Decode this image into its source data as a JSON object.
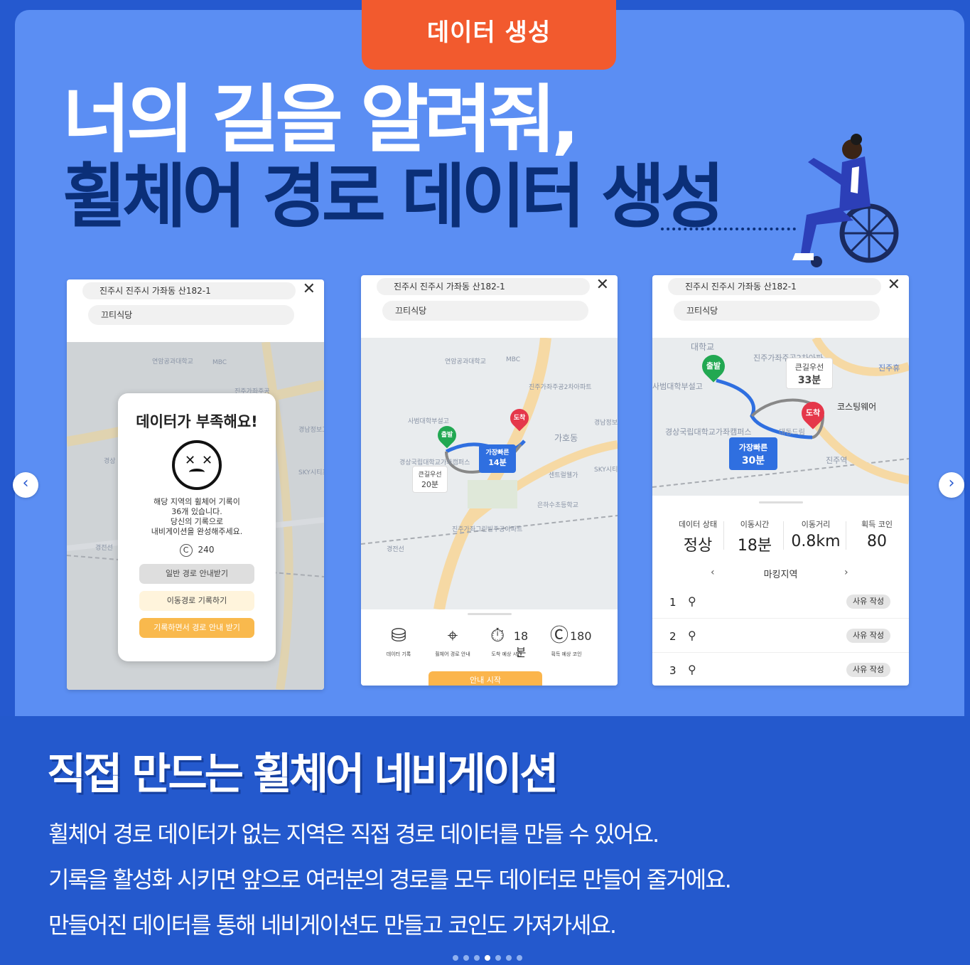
{
  "tag": "데이터 생성",
  "headline": {
    "line1": "너의 길을 알려줘,",
    "line2": "휠체어 경로 데이터 생성"
  },
  "phone1": {
    "address": "진주시 진주시 가좌동 산182-1",
    "place": "끄티식당",
    "dialog": {
      "title": "데이터가 부족해요!",
      "text_lines": [
        "해당 지역의 휠체어 기록이",
        "36개 있습니다.",
        "당신의 기록으로",
        "내비게이션을 완성해주세요."
      ],
      "coin_value": "240",
      "btn_normal": "일반 경로 안내받기",
      "btn_record": "이동경로 기록하기",
      "btn_guide": "기록하면서 경로 안내 받기"
    },
    "map_labels": [
      "연암공과대학교",
      "MBC",
      "진주가좌주공",
      "경남정보고등학교",
      "경상",
      "SKY시티프라디움",
      "경전선"
    ]
  },
  "phone2": {
    "address": "진주시 진주시 가좌동 산182-1",
    "place": "끄티식당",
    "pin_start": "출발",
    "pin_end": "도착",
    "fast_route": {
      "label": "가장빠른",
      "time": "14분"
    },
    "big_route": {
      "label": "큰길우선",
      "time": "20분"
    },
    "map_labels": [
      "연암공과대학교",
      "MBC",
      "진주가좌주공2차아파트",
      "사범대학부설고",
      "가호동",
      "경남정보고등학교",
      "경상국립대학교가좌캠퍼스",
      "센트럴웰가",
      "SKY시티프라디움",
      "은하수초등학교",
      "진주가좌그린빌주공아파트",
      "경전선"
    ],
    "tools": [
      {
        "icon": "database-add-icon",
        "label": "데이터 기록",
        "value": ""
      },
      {
        "icon": "map-pin-icon",
        "label": "휠체어 경로 안내",
        "value": ""
      },
      {
        "icon": "timer-icon",
        "label": "도착 예상 시간",
        "value": "18분"
      },
      {
        "icon": "coin-icon",
        "label": "획득 예상 코인",
        "value": "180"
      }
    ],
    "start_button": "안내 시작"
  },
  "phone3": {
    "address": "진주시 진주시 가좌동 산182-1",
    "place": "끄티식당",
    "pin_start": "출발",
    "pin_end": "도착",
    "big_route": {
      "label": "큰길우선",
      "time": "33분"
    },
    "fast_route": {
      "label": "가장빠른",
      "time": "30분"
    },
    "map_labels": [
      "대학교",
      "진주가좌주공2차아파",
      "진주휴",
      "사범대학부설고",
      "코스팅웨어",
      "경상국립대학교가좌캠퍼스",
      "진주역",
      "대동드림"
    ],
    "stats": [
      {
        "key": "데이터 상태",
        "value": "정상"
      },
      {
        "key": "이동시간",
        "value": "18분"
      },
      {
        "key": "이동거리",
        "value": "0.8km"
      },
      {
        "key": "획득 코인",
        "value": "80"
      }
    ],
    "marking_title": "마킹지역",
    "markings": [
      {
        "num": "1",
        "action": "사유 작성"
      },
      {
        "num": "2",
        "action": "사유 작성"
      },
      {
        "num": "3",
        "action": "사유 작성"
      }
    ]
  },
  "section": {
    "title": "직접 만드는 휠체어 네비게이션",
    "lines": [
      "휠체어 경로 데이터가 없는 지역은 직접 경로 데이터를 만들 수 있어요.",
      "기록을 활성화 시키면 앞으로 여러분의 경로를 모두 데이터로 만들어 줄거에요.",
      "만들어진 데이터를 통해 네비게이션도 만들고 코인도 가져가세요."
    ]
  },
  "nav": {
    "prev_icon": "chevron-left-icon",
    "next_icon": "chevron-right-icon"
  },
  "pagination": {
    "total": 7,
    "active": 4
  },
  "colors": {
    "background": "#2559cf",
    "panel": "#5b8ef3",
    "tag": "#f25a2e",
    "headline_dark": "#0b2f78",
    "route": "#2f6fe0"
  }
}
